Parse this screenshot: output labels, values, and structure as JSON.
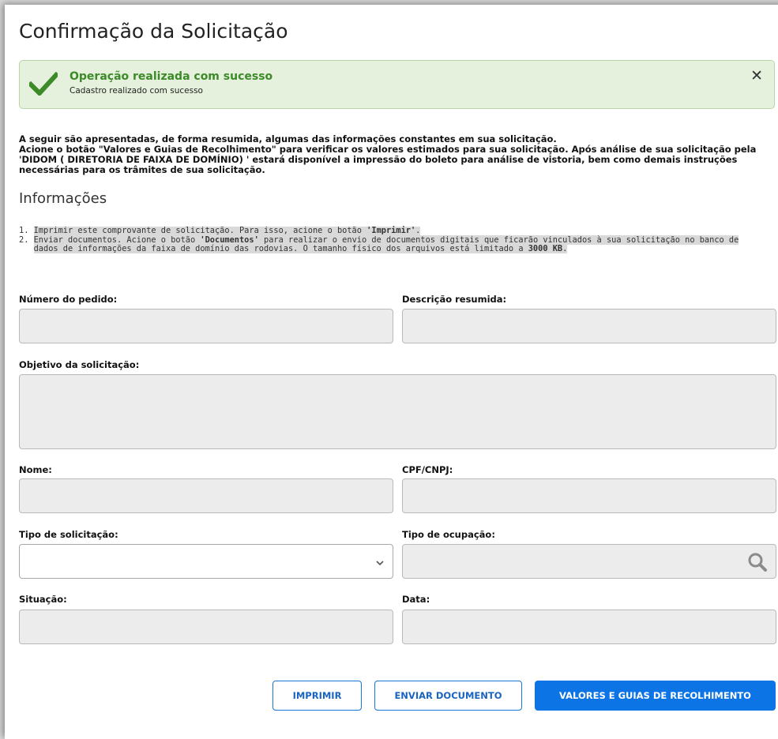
{
  "page": {
    "title": "Confirmação da Solicitação"
  },
  "alert": {
    "title": "Operação realizada com sucesso",
    "message": "Cadastro realizado com sucesso",
    "close_label": "✕"
  },
  "intro": {
    "line1": "A seguir são apresentadas, de forma resumida, algumas das informações constantes em sua solicitação.",
    "line2": "Acione o botão \"Valores e Guias de Recolhimento\" para verificar os valores estimados para sua solicitação. Após análise de sua solicitação pela 'DIDOM ( DIRETORIA DE FAIXA DE DOMÍNIO) ' estará disponível a impressão do boleto para análise de vistoria, bem como demais instruções necessárias para os trâmites de sua solicitação."
  },
  "info": {
    "title": "Informações",
    "item1_num": "1.",
    "item1_pre": "Imprimir este comprovante de solicitação. Para isso, acione o botão ",
    "item1_bold": "'Imprimir'",
    "item1_post": ".",
    "item2_num": "2.",
    "item2_pre": "Enviar documentos. Acione o botão ",
    "item2_bold": "'Documentos'",
    "item2_mid": " para realizar o envio de documentos digitais que ficarão vinculados à sua solicitação no banco de dados de informações da faixa de domínio das rodovias. O tamanho físico dos arquivos está limitado a ",
    "item2_bold2": "3000 KB",
    "item2_post": "."
  },
  "form": {
    "numero_label": "Número do pedido:",
    "descricao_label": "Descrição resumida:",
    "objetivo_label": "Objetivo da solicitação:",
    "nome_label": "Nome:",
    "cpf_label": "CPF/CNPJ:",
    "tipo_solicitacao_label": "Tipo de solicitação:",
    "tipo_ocupacao_label": "Tipo de ocupação:",
    "situacao_label": "Situação:",
    "data_label": "Data:"
  },
  "buttons": {
    "imprimir": "IMPRIMIR",
    "enviar": "ENVIAR DOCUMENTO",
    "valores": "VALORES E GUIAS DE RECOLHIMENTO"
  },
  "icons": {
    "success": "check-icon",
    "close": "close-icon",
    "dropdown": "chevron-down-icon",
    "search": "search-icon"
  },
  "colors": {
    "success_text": "#3c8a28",
    "success_bg": "#e5f1dc",
    "primary": "#0d74e6"
  }
}
